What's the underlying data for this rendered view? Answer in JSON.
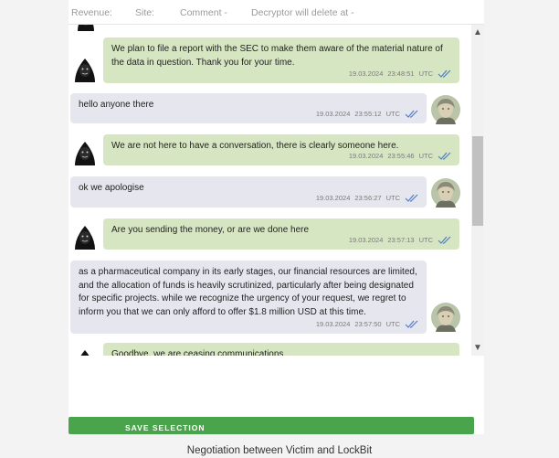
{
  "header": {
    "revenue_label": "Revenue:",
    "site_label": "Site:",
    "comment_label": "Comment -",
    "decryptor_label": "Decryptor will delete at -"
  },
  "messages": [
    {
      "sender": "attacker",
      "text": "We plan to file a report with the SEC to make them aware of the material nature of the data in question. Thank you for your time.",
      "date": "19.03.2024",
      "time": "23:48:51",
      "tz": "UTC"
    },
    {
      "sender": "victim",
      "text": "hello anyone there",
      "date": "19.03.2024",
      "time": "23:55:12",
      "tz": "UTC"
    },
    {
      "sender": "attacker",
      "text": "We are not here to have a conversation, there is clearly someone here.",
      "date": "19.03.2024",
      "time": "23:55:46",
      "tz": "UTC"
    },
    {
      "sender": "victim",
      "text": "ok we apologise",
      "date": "19.03.2024",
      "time": "23:56:27",
      "tz": "UTC"
    },
    {
      "sender": "attacker",
      "text": "Are you sending the money, or are we done here",
      "date": "19.03.2024",
      "time": "23:57:13",
      "tz": "UTC"
    },
    {
      "sender": "victim",
      "text": "as a pharmaceutical company in its early stages, our financial resources are limited, and the allocation of funds is heavily scrutinized, particularly after being designated for specific projects. while we recognize the urgency of your request, we regret to inform you that we can only afford to offer $1.8 million USD at this time.",
      "date": "19.03.2024",
      "time": "23:57:50",
      "tz": "UTC"
    },
    {
      "sender": "attacker",
      "text": "Goodbye, we are ceasing communications",
      "date": "",
      "time": "",
      "tz": ""
    }
  ],
  "footer": {
    "save_label": "SAVE SELECTION",
    "caption": "Negotiation between Victim and LockBit"
  },
  "colors": {
    "attacker_bubble": "#d7e6c2",
    "victim_bubble": "#e6e6ef",
    "save_button": "#49a44b",
    "tick": "#4a7fd4"
  }
}
